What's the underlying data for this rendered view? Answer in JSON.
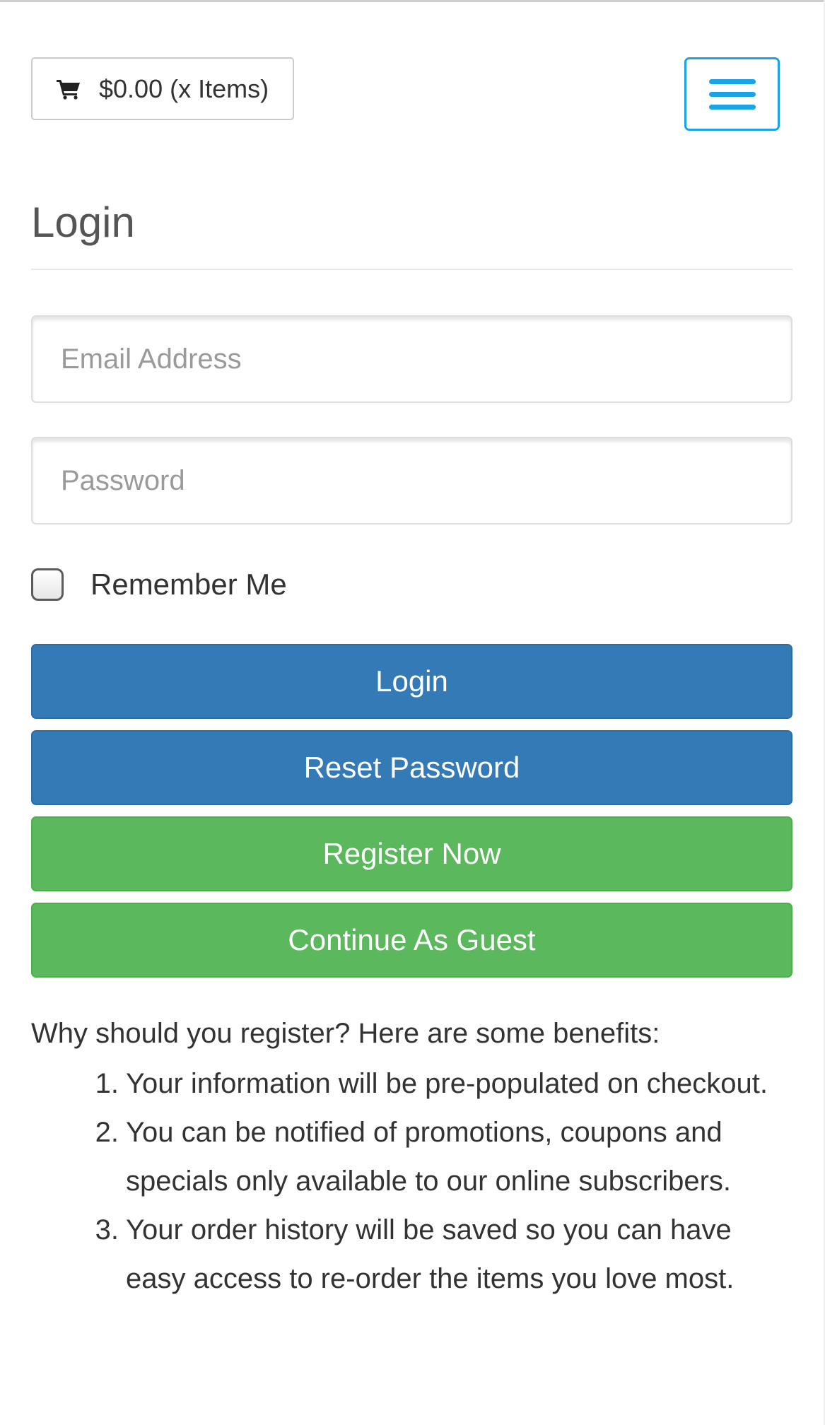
{
  "header": {
    "cart_label": "$0.00 (x Items)",
    "cart_icon": "shopping-cart-icon",
    "menu_icon": "hamburger-menu-icon"
  },
  "page": {
    "title": "Login"
  },
  "form": {
    "email_placeholder": "Email Address",
    "email_value": "",
    "password_placeholder": "Password",
    "password_value": "",
    "remember_label": "Remember Me",
    "remember_checked": false
  },
  "buttons": {
    "login": "Login",
    "reset": "Reset Password",
    "register": "Register Now",
    "guest": "Continue As Guest"
  },
  "benefits": {
    "intro": "Why should you register? Here are some benefits:",
    "items": [
      {
        "num": "1.",
        "text": "Your information will be pre-populated on checkout."
      },
      {
        "num": "2.",
        "text": "You can be notified of promotions, coupons and specials only available to our online subscribers."
      },
      {
        "num": "3.",
        "text": "Your order history will be saved so you can have easy access to re-order the items you love most."
      }
    ]
  },
  "colors": {
    "primary": "#337ab7",
    "success": "#5cb85c",
    "menu_accent": "#1aa4e6"
  }
}
